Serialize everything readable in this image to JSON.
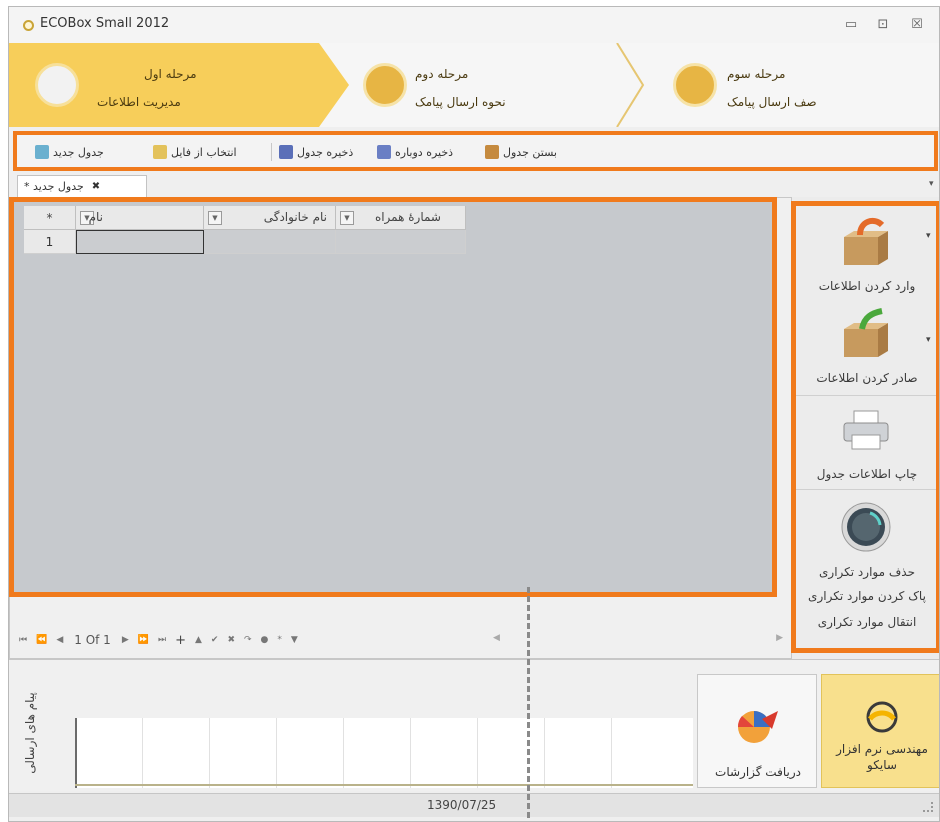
{
  "window": {
    "title": "ECOBox Small 2012",
    "controls": {
      "minimize": "▭",
      "maximize": "⊡",
      "close": "☒"
    }
  },
  "wizard": {
    "steps": [
      {
        "title": "مرحله اول",
        "subtitle": "مدیریت اطلاعات",
        "active": true
      },
      {
        "title": "مرحله دوم",
        "subtitle": "نحوه ارسال پیامک",
        "active": false
      },
      {
        "title": "مرحله سوم",
        "subtitle": "صف ارسال پیامک",
        "active": false
      }
    ]
  },
  "toolbar": {
    "close_table": "بستن جدول",
    "save_again": "ذخیره دوباره",
    "save_table": "ذخیره جدول",
    "select_file": "انتخاب از فایل",
    "new_table": "جدول جدید"
  },
  "tabs": [
    {
      "label": "جدول جدید *",
      "close": "✖"
    }
  ],
  "grid": {
    "columns": [
      "*",
      "نام",
      "نام خانوادگی",
      "شمارهٔ همراه"
    ],
    "rows": [
      [
        "1",
        "",
        "",
        ""
      ]
    ],
    "filter_glyph": "▼"
  },
  "navigator": {
    "page_text": "1 Of 1",
    "buttons": [
      "⏮",
      "⏪",
      "◀",
      "▶",
      "⏩",
      "⏭",
      "+",
      "▲",
      "✔",
      "✖",
      "↷",
      "●",
      "*",
      "▼"
    ]
  },
  "right_panel": {
    "import_label": "وارد کردن اطلاعات",
    "export_label": "صادر کردن اطلاعات",
    "print_label": "چاپ اطلاعات جدول",
    "dup_delete": "حذف موارد تکراری",
    "dup_clean": "پاک کردن موارد تکراری",
    "dup_move": "انتقال موارد تکراری",
    "dropdown_glyph": "▾"
  },
  "bottom": {
    "chart_title": "پیام های ارسالی",
    "reports_label": "دریافت گزارشات",
    "company_label": "مهندسی نرم افزار سایکو"
  },
  "status": {
    "date": "1390/07/25"
  },
  "colors": {
    "accent": "#f07a1c",
    "wizard_active": "#f7ce5a",
    "step_circle": "#e7b544"
  }
}
